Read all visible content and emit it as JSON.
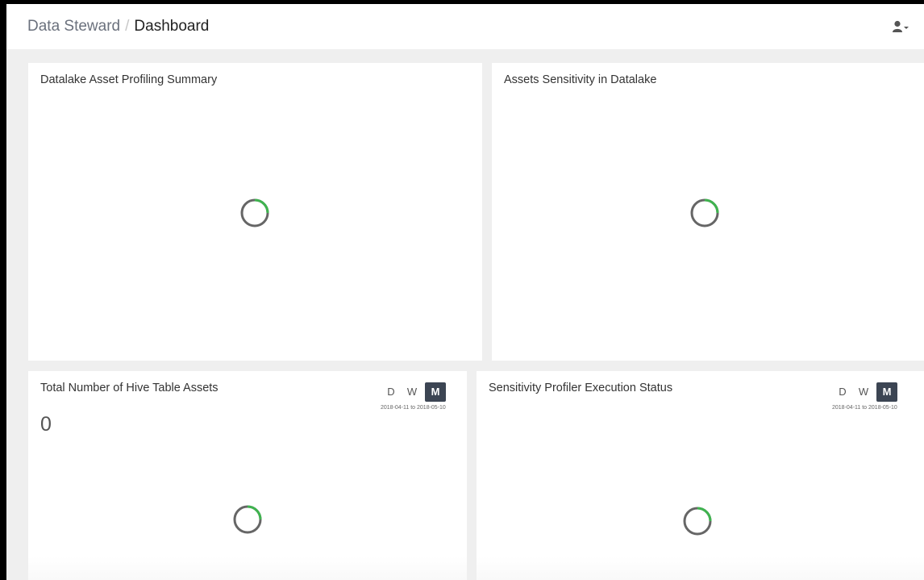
{
  "header": {
    "breadcrumb_root": "Data Steward",
    "breadcrumb_separator": "/",
    "breadcrumb_current": "Dashboard",
    "user_icon": "user-icon",
    "dropdown_icon": "caret-down-icon"
  },
  "cards": {
    "profiling_summary": {
      "title": "Datalake Asset Profiling Summary"
    },
    "sensitivity": {
      "title": "Assets Sensitivity in Datalake"
    },
    "hive_assets": {
      "title": "Total Number of Hive Table Assets",
      "value": "0",
      "periods": [
        "D",
        "W",
        "M"
      ],
      "active_period": "M",
      "range": "2018-04-11 to 2018-05-10"
    },
    "profiler_status": {
      "title": "Sensitivity Profiler Execution Status",
      "periods": [
        "D",
        "W",
        "M"
      ],
      "active_period": "M",
      "range": "2018-04-11 to 2018-05-10"
    }
  },
  "colors": {
    "spinner_track": "#666666",
    "spinner_accent": "#3fb34f",
    "active_period_bg": "#3c4553"
  }
}
